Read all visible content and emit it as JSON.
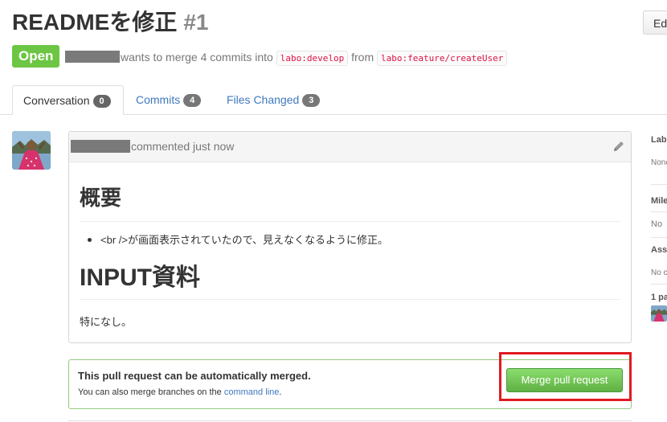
{
  "header": {
    "title": "READMEを修正",
    "number": "#1",
    "edit_label": "Ed"
  },
  "meta": {
    "state": "Open",
    "text_before": "wants to merge 4 commits into",
    "base_branch": "labo:develop",
    "from_text": "from",
    "head_branch": "labo:feature/createUser"
  },
  "tabs": [
    {
      "label": "Conversation",
      "count": "0"
    },
    {
      "label": "Commits",
      "count": "4"
    },
    {
      "label": "Files Changed",
      "count": "3"
    }
  ],
  "comment": {
    "meta": "commented just now",
    "heading1": "概要",
    "bullet": "<br />が画面表示されていたので、見えなくなるように修正。",
    "heading2": "INPUT資料",
    "body": "特になし。"
  },
  "merge": {
    "title": "This pull request can be automatically merged.",
    "sub_before": "You can also merge branches on the",
    "sub_link": "command line",
    "sub_after": ".",
    "button": "Merge pull request"
  },
  "sidebar": {
    "labels_title": "Lab",
    "labels_value": "None",
    "milestone_title": "Mile",
    "milestone_value": "No",
    "assignee_title": "Ass",
    "assignee_value": "No c",
    "participants_title": "1 pa"
  },
  "colors": {
    "open_badge": "#6cc644",
    "merge_button": "#6cc644",
    "link": "#4078c0",
    "highlight": "#e01a22"
  }
}
